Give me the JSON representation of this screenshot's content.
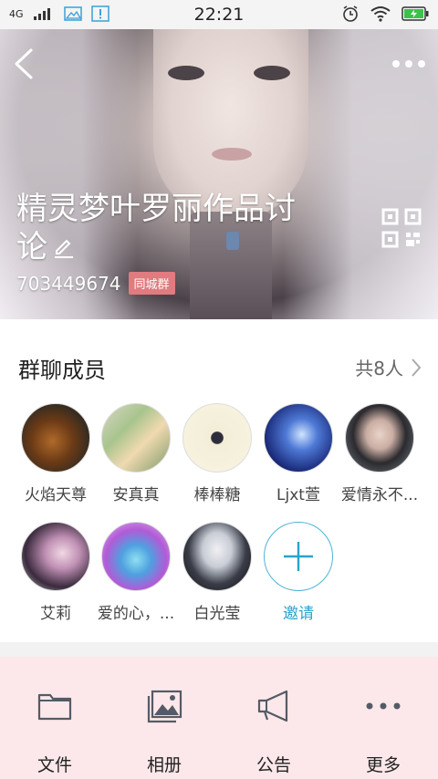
{
  "status_bar": {
    "network": "4G",
    "time": "22:21"
  },
  "group": {
    "title": "精灵梦叶罗丽作品讨论",
    "id": "703449674",
    "badge": "同城群"
  },
  "members_section": {
    "title": "群聊成员",
    "count": "共8人"
  },
  "members": [
    {
      "name": "火焰天尊"
    },
    {
      "name": "安真真"
    },
    {
      "name": "棒棒糖"
    },
    {
      "name": "Ljxt萱"
    },
    {
      "name": "爱情永不..."
    },
    {
      "name": "艾莉"
    },
    {
      "name": "爱的心，..."
    },
    {
      "name": "白光莹"
    }
  ],
  "invite": {
    "label": "邀请"
  },
  "toolbar": {
    "items": [
      {
        "label": "文件",
        "icon": "folder-icon"
      },
      {
        "label": "相册",
        "icon": "album-icon"
      },
      {
        "label": "公告",
        "icon": "megaphone-icon"
      },
      {
        "label": "更多",
        "icon": "more-dots-icon"
      }
    ]
  },
  "colors": {
    "accent": "#28a3cf",
    "badge": "#e07b80",
    "toolbar_bg": "#fce8ea"
  }
}
